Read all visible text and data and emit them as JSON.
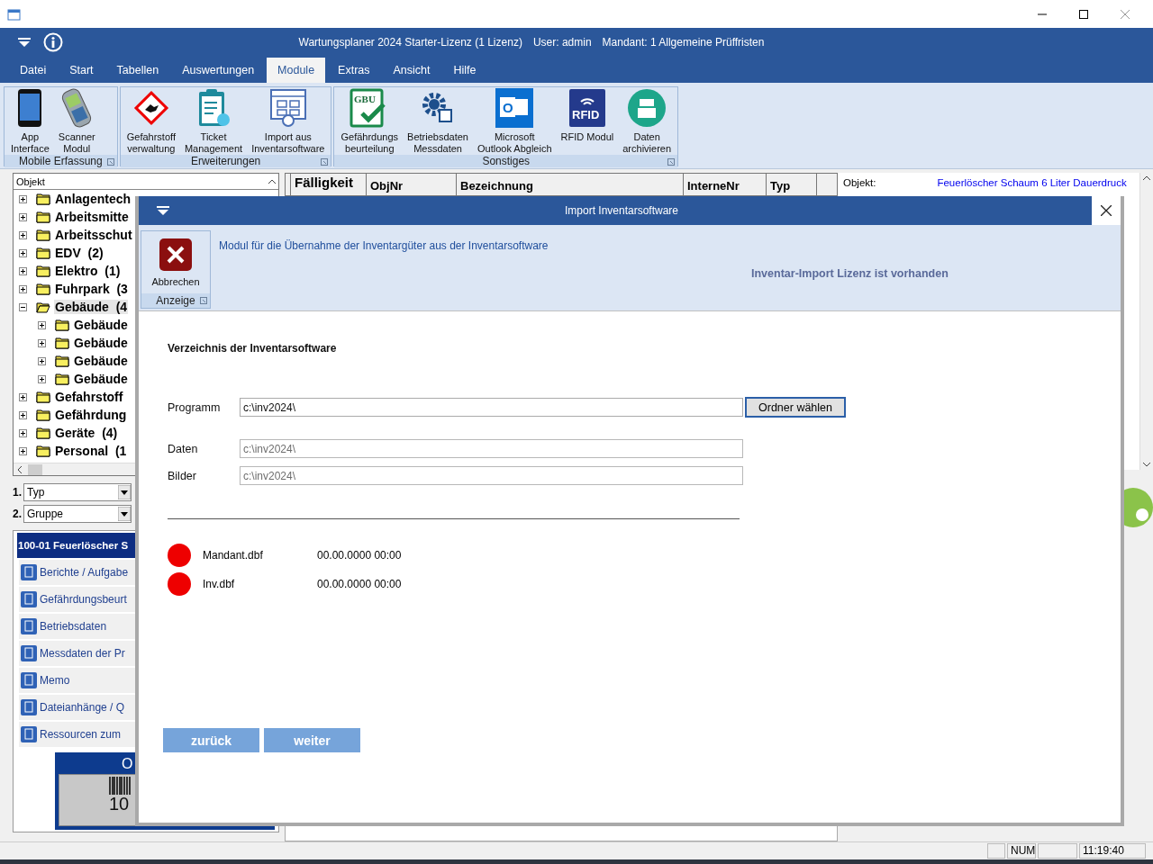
{
  "app_header": {
    "title": "Wartungsplaner 2024 Starter-Lizenz (1 Lizenz)",
    "user": "User: admin",
    "mandant": "Mandant: 1 Allgemeine Prüffristen"
  },
  "menu": [
    {
      "label": "Datei",
      "selected": false
    },
    {
      "label": "Start",
      "selected": false
    },
    {
      "label": "Tabellen",
      "selected": false
    },
    {
      "label": "Auswertungen",
      "selected": false
    },
    {
      "label": "Module",
      "selected": true
    },
    {
      "label": "Extras",
      "selected": false
    },
    {
      "label": "Ansicht",
      "selected": false
    },
    {
      "label": "Hilfe",
      "selected": false
    }
  ],
  "ribbon": [
    {
      "label": "Mobile Erfassung",
      "buttons": [
        {
          "kind": "phone",
          "lines": [
            "App",
            "Interface"
          ]
        },
        {
          "kind": "scanner",
          "lines": [
            "Scanner",
            "Modul"
          ]
        }
      ]
    },
    {
      "label": "Erweiterungen",
      "buttons": [
        {
          "kind": "hazard",
          "lines": [
            "Gefahrstoff",
            "verwaltung"
          ]
        },
        {
          "kind": "clipboard",
          "lines": [
            "Ticket",
            "Management"
          ]
        },
        {
          "kind": "import",
          "lines": [
            "Import aus",
            "Inventarsoftware"
          ]
        }
      ]
    },
    {
      "label": "Sonstiges",
      "buttons": [
        {
          "kind": "gbu",
          "icon_text": "GBU",
          "lines": [
            "Gefährdungs",
            "beurteilung"
          ]
        },
        {
          "kind": "gear",
          "lines": [
            "Betriebsdaten",
            "Messdaten"
          ]
        },
        {
          "kind": "outlook",
          "icon_text": "O",
          "lines": [
            "Microsoft",
            "Outlook Abgleich"
          ]
        },
        {
          "kind": "rfid",
          "icon_text": "RFID",
          "lines": [
            "RFID Modul"
          ]
        },
        {
          "kind": "archive",
          "lines": [
            "Daten",
            "archivieren"
          ]
        }
      ]
    }
  ],
  "tree": {
    "header": "Objekt",
    "items": [
      {
        "label": "Anlagentech",
        "expanded": false,
        "selected": false
      },
      {
        "label": "Arbeitsmitte",
        "expanded": false,
        "selected": false
      },
      {
        "label": "Arbeitsschut",
        "expanded": false,
        "selected": false
      },
      {
        "label": "EDV  (2)",
        "expanded": false,
        "selected": false
      },
      {
        "label": "Elektro  (1)",
        "expanded": false,
        "selected": false
      },
      {
        "label": "Fuhrpark  (3",
        "expanded": false,
        "selected": false
      },
      {
        "label": "Gebäude  (4",
        "expanded": true,
        "selected": true,
        "children": [
          {
            "label": "Gebäude",
            "expanded": false,
            "selected": false
          },
          {
            "label": "Gebäude",
            "expanded": false,
            "selected": false
          },
          {
            "label": "Gebäude",
            "expanded": false,
            "selected": false
          },
          {
            "label": "Gebäude",
            "expanded": false,
            "selected": false
          }
        ]
      },
      {
        "label": "Gefahrstoff",
        "expanded": false,
        "selected": false
      },
      {
        "label": "Gefährdung",
        "expanded": false,
        "selected": false
      },
      {
        "label": "Geräte  (4)",
        "expanded": false,
        "selected": false
      },
      {
        "label": "Personal  (1",
        "expanded": false,
        "selected": false
      }
    ]
  },
  "filters": [
    {
      "number": "1.",
      "value": "Typ"
    },
    {
      "number": "2.",
      "value": "Gruppe"
    }
  ],
  "record": {
    "title": "100-01 Feuerlöscher S",
    "links": [
      "Berichte / Aufgabe",
      "Gefährdungsbeurt",
      "Betriebsdaten",
      "Messdaten der Pr",
      "Memo",
      "Dateianhänge / Q",
      "Ressourcen zum"
    ],
    "label_card": {
      "text": "O",
      "number": "10"
    }
  },
  "grid": {
    "columns": [
      "Fälligkeit",
      "ObjNr",
      "Bezeichnung",
      "InterneNr",
      "Typ"
    ]
  },
  "detail": {
    "label": "Objekt:",
    "value": "Feuerlöscher Schaum 6 Liter Dauerdruck"
  },
  "status_bar": [
    "NUM",
    "11:19:40"
  ],
  "dialog": {
    "title": "Import Inventarsoftware",
    "ribbon_group": "Anzeige",
    "cancel_button": "Abbrechen",
    "description": "Modul für die Übernahme der Inventargüter aus der Inventarsoftware",
    "license_status": "Inventar-Import Lizenz ist vorhanden",
    "section_title": "Verzeichnis der Inventarsoftware",
    "fields": [
      {
        "label": "Programm",
        "value": "c:\\inv2024\\",
        "disabled": false
      },
      {
        "label": "Daten",
        "value": "c:\\inv2024\\",
        "disabled": true
      },
      {
        "label": "Bilder",
        "value": "c:\\inv2024\\",
        "disabled": true
      }
    ],
    "browse_button": "Ordner wählen",
    "files": [
      {
        "name": "Mandant.dbf",
        "date": "00.00.0000 00:00",
        "color": "#ee0000"
      },
      {
        "name": "Inv.dbf",
        "date": "00.00.0000 00:00",
        "color": "#ee0000"
      }
    ],
    "nav_buttons": [
      "zurück",
      "weiter"
    ]
  }
}
